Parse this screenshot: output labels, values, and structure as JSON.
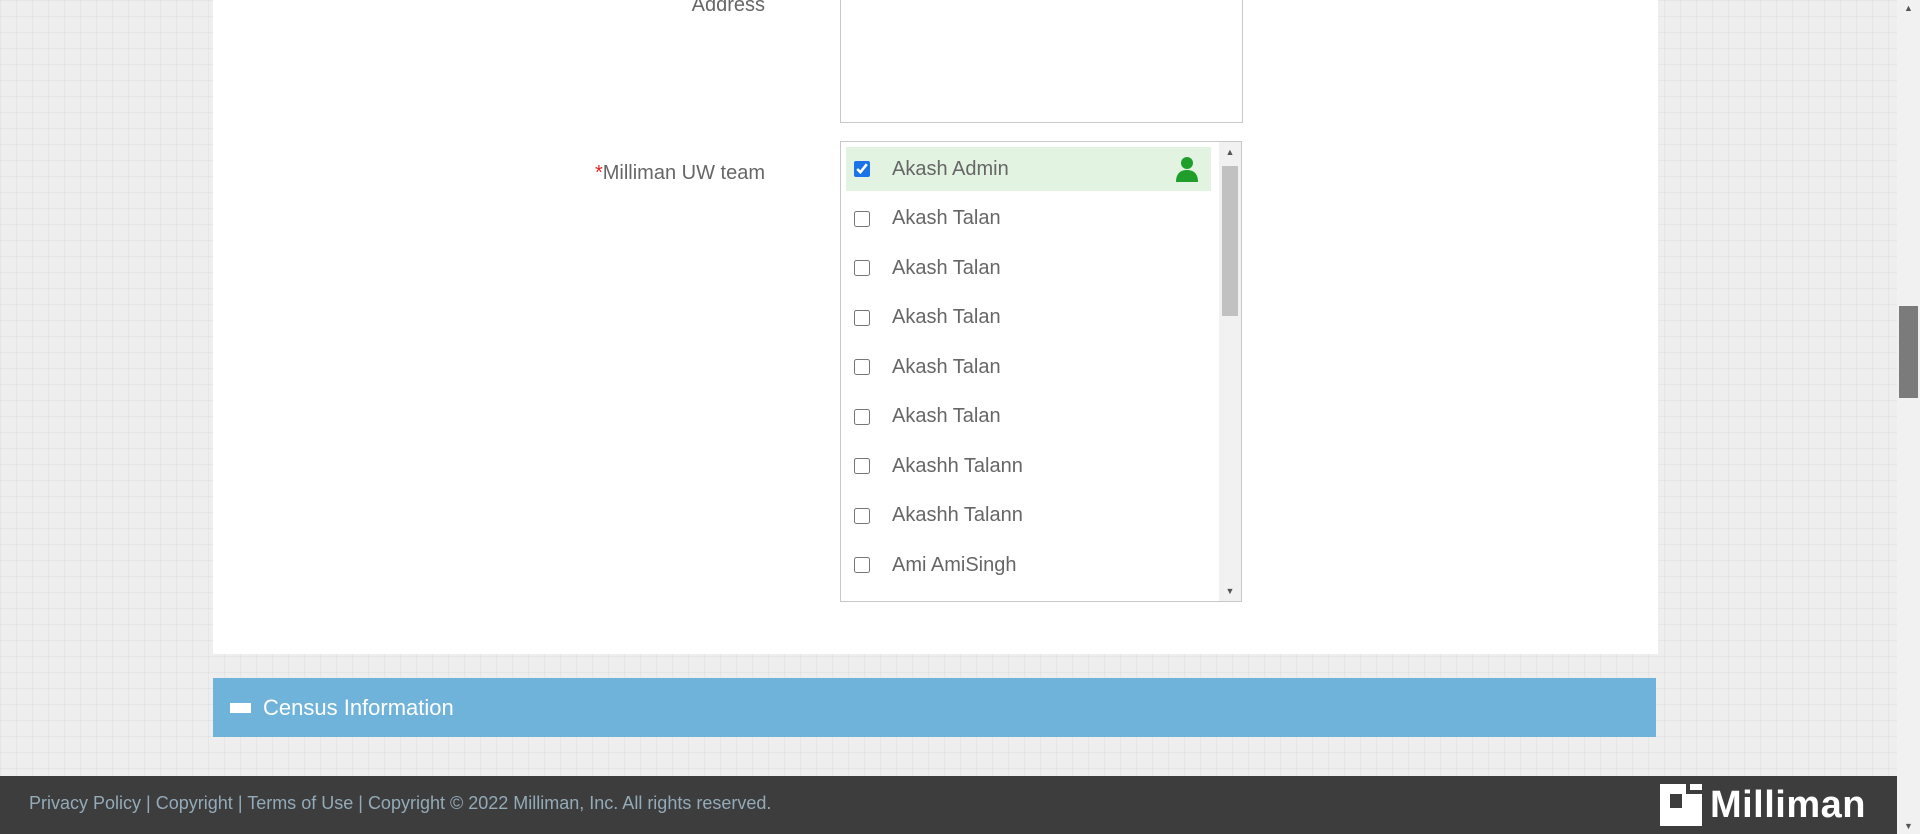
{
  "form": {
    "address_label": "Address",
    "team_required_marker": "*",
    "team_label": "Milliman UW team",
    "team_members": [
      {
        "name": "Akash Admin",
        "checked": true,
        "icon": "user-icon"
      },
      {
        "name": "Akash Talan",
        "checked": false
      },
      {
        "name": "Akash Talan",
        "checked": false
      },
      {
        "name": "Akash Talan",
        "checked": false
      },
      {
        "name": "Akash Talan",
        "checked": false
      },
      {
        "name": "Akash Talan",
        "checked": false
      },
      {
        "name": "Akashh Talann",
        "checked": false
      },
      {
        "name": "Akashh Talann",
        "checked": false
      },
      {
        "name": "Ami AmiSingh",
        "checked": false
      }
    ]
  },
  "census": {
    "title": "Census Information",
    "icon": "collapse-minus-icon"
  },
  "footer": {
    "links": {
      "privacy": "Privacy Policy",
      "copyright": "Copyright",
      "terms": "Terms of Use"
    },
    "separator": "|",
    "notice": "Copyright © 2022 Milliman, Inc. All rights reserved.",
    "logo_text": "Milliman"
  },
  "colors": {
    "section_header": "#6fb3db",
    "footer_bg": "#3d3d3d",
    "required": "#e02424",
    "selected_row": "#e3f3e2",
    "user_icon": "#1f9e2c"
  }
}
